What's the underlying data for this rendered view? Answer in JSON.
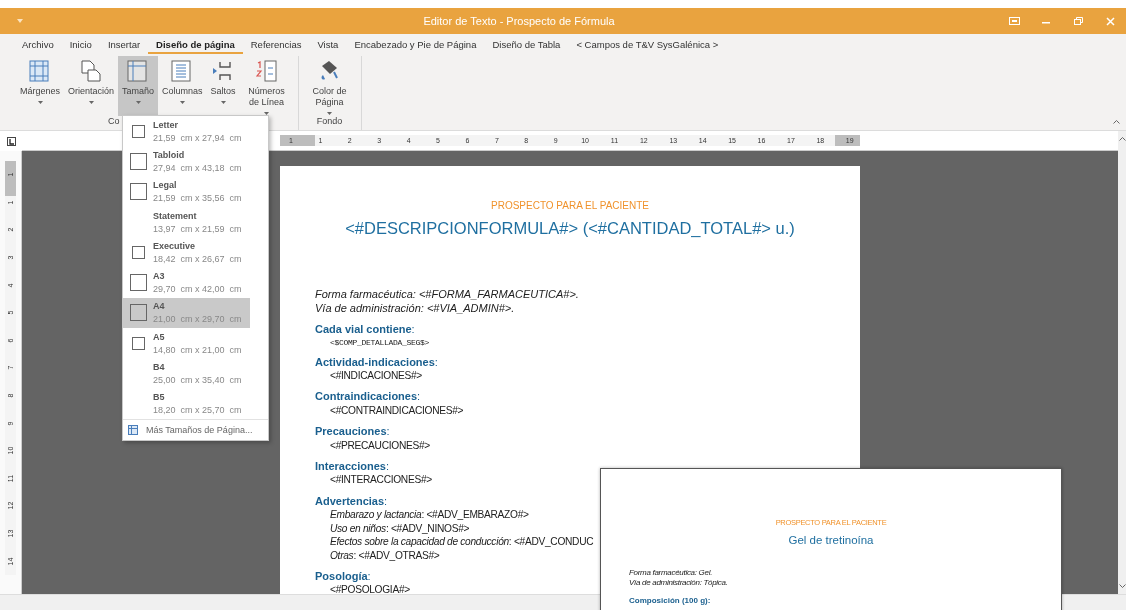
{
  "window": {
    "title": "Editor de Texto - Prospecto de Fórmula"
  },
  "menu_tabs": [
    {
      "label": "Archivo",
      "selected": false
    },
    {
      "label": "Inicio",
      "selected": false
    },
    {
      "label": "Insertar",
      "selected": false
    },
    {
      "label": "Diseño de página",
      "selected": true
    },
    {
      "label": "Referencias",
      "selected": false
    },
    {
      "label": "Vista",
      "selected": false
    },
    {
      "label": "Encabezado y Pie de Página",
      "selected": false
    },
    {
      "label": "Diseño de Tabla",
      "selected": false
    },
    {
      "label": "< Campos de T&V SysGalénica >",
      "selected": false
    }
  ],
  "ribbon": {
    "groups": [
      {
        "label": "Co",
        "buttons": [
          {
            "label": "Márgenes",
            "selected": false
          },
          {
            "label": "Orientación",
            "selected": false
          },
          {
            "label": "Tamaño",
            "selected": true
          },
          {
            "label": "Columnas",
            "selected": false
          },
          {
            "label": "Saltos",
            "selected": false
          },
          {
            "label": "Números de Línea",
            "selected": false
          }
        ]
      },
      {
        "label": "Fondo",
        "buttons": [
          {
            "label": "Color de Página",
            "selected": false
          }
        ]
      }
    ]
  },
  "size_menu": {
    "items": [
      {
        "name": "Letter",
        "size": "21,59  cm x 27,94  cm",
        "kind": "small",
        "selected": false
      },
      {
        "name": "Tabloid",
        "size": "27,94  cm x 43,18  cm",
        "kind": "large",
        "selected": false
      },
      {
        "name": "Legal",
        "size": "21,59  cm x 35,56  cm",
        "kind": "large",
        "selected": false
      },
      {
        "name": "Statement",
        "size": "13,97  cm x 21,59  cm",
        "kind": "none",
        "selected": false
      },
      {
        "name": "Executive",
        "size": "18,42  cm x 26,67  cm",
        "kind": "small",
        "selected": false
      },
      {
        "name": "A3",
        "size": "29,70  cm x 42,00  cm",
        "kind": "large",
        "selected": false
      },
      {
        "name": "A4",
        "size": "21,00  cm x 29,70  cm",
        "kind": "large",
        "selected": true
      },
      {
        "name": "A5",
        "size": "14,80  cm x 21,00  cm",
        "kind": "small",
        "selected": false
      },
      {
        "name": "B4",
        "size": "25,00  cm x 35,40  cm",
        "kind": "none",
        "selected": false
      },
      {
        "name": "B5",
        "size": "18,20  cm x 25,70  cm",
        "kind": "none",
        "selected": false
      }
    ],
    "footer": "Más Tamaños de Página..."
  },
  "ruler": {
    "horizontal": [
      "1",
      "1",
      "2",
      "3",
      "4",
      "5",
      "6",
      "7",
      "8",
      "9",
      "10",
      "11",
      "12",
      "13",
      "14",
      "15",
      "16",
      "17",
      "18",
      "19"
    ],
    "vertical": [
      "1",
      "1",
      "2",
      "3",
      "4",
      "5",
      "6",
      "7",
      "8",
      "9",
      "10",
      "11",
      "12",
      "13",
      "14"
    ]
  },
  "document": {
    "header": "PROSPECTO PARA EL PACIENTE",
    "title": "<#DESCRIPCIONFORMULA#> (<#CANTIDAD_TOTAL#> u.)",
    "intro": [
      "Forma farmacéutica: <#FORMA_FARMACEUTICA#>.",
      "Vía de administración: <#VIA_ADMIN#>."
    ],
    "sections": [
      {
        "heading": "**Cada vial contiene**:",
        "mono": true,
        "lines": [
          "<$COMP_DETALLADA_SEG$>"
        ]
      },
      {
        "heading": "**Actividad-indicaciones**:",
        "mono": false,
        "lines": [
          "<#INDICACIONES#>"
        ]
      },
      {
        "heading": "**Contraindicaciones**:",
        "mono": false,
        "lines": [
          "<#CONTRAINDICACIONES#>"
        ]
      },
      {
        "heading": "**Precauciones**:",
        "mono": false,
        "lines": [
          "<#PRECAUCIONES#>"
        ]
      },
      {
        "heading": "**Interacciones**:",
        "mono": false,
        "lines": [
          "<#INTERACCIONES#>"
        ]
      },
      {
        "heading": "**Advertencias**:",
        "mono": false,
        "lines": [
          "*Embarazo y lactancia*: <#ADV_EMBARAZO#>",
          "*Uso en niños*: <#ADV_NINOS#>",
          "*Efectos sobre la capacidad de conducción*: <#ADV_CONDUC",
          "*Otras*: <#ADV_OTRAS#>"
        ]
      },
      {
        "heading": "**Posología**:",
        "mono": false,
        "lines": [
          "<#POSOLOGIA#>"
        ]
      }
    ]
  },
  "preview": {
    "header": "PROSPECTO PARA EL PACIENTE",
    "title": "Gel de tretinoína",
    "intro": [
      "Forma farmacéutica: Gel.",
      "Vía de administración: Tópica."
    ],
    "heading": "Composición (100 g):"
  }
}
